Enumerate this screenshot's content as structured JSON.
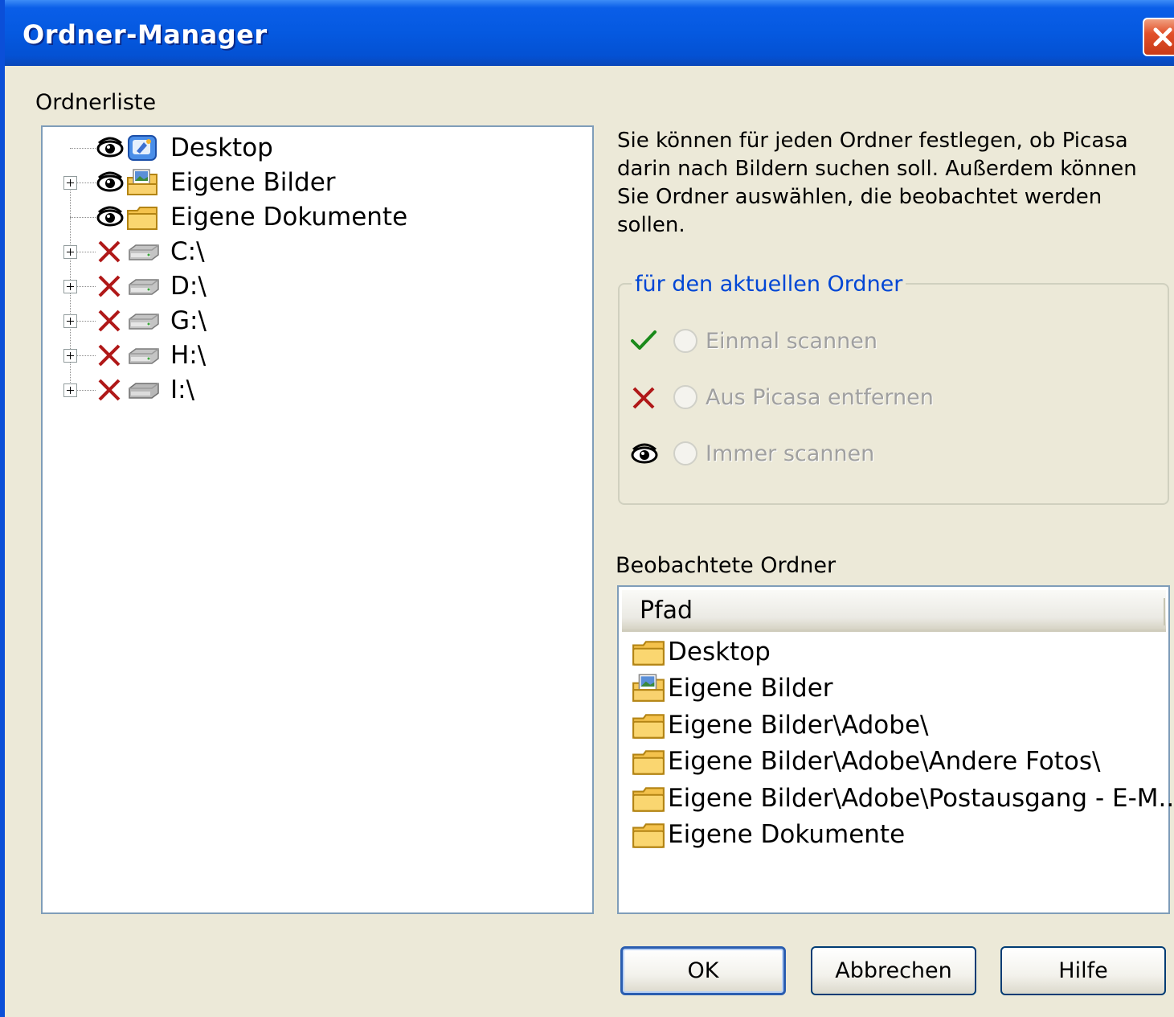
{
  "window": {
    "title": "Ordner-Manager"
  },
  "folder_list": {
    "label": "Ordnerliste",
    "items": [
      {
        "label": "Desktop",
        "status_icon": "eye-icon",
        "type_icon": "desktop-icon",
        "expandable": false
      },
      {
        "label": "Eigene Bilder",
        "status_icon": "eye-icon",
        "type_icon": "pictures-folder-icon",
        "expandable": true
      },
      {
        "label": "Eigene Dokumente",
        "status_icon": "eye-icon",
        "type_icon": "folder-icon",
        "expandable": false
      },
      {
        "label": "C:\\",
        "status_icon": "x-icon",
        "type_icon": "drive-icon",
        "expandable": true
      },
      {
        "label": "D:\\",
        "status_icon": "x-icon",
        "type_icon": "drive-icon",
        "expandable": true
      },
      {
        "label": "G:\\",
        "status_icon": "x-icon",
        "type_icon": "drive-icon",
        "expandable": true
      },
      {
        "label": "H:\\",
        "status_icon": "x-icon",
        "type_icon": "drive-icon",
        "expandable": true
      },
      {
        "label": "I:\\",
        "status_icon": "x-icon",
        "type_icon": "drive-icon",
        "expandable": true
      }
    ]
  },
  "description": "Sie können für jeden Ordner festlegen, ob Picasa darin nach Bildern suchen soll. Außerdem können Sie Ordner auswählen, die beobachtet werden sollen.",
  "current_folder_group": {
    "legend": "für den aktuellen Ordner",
    "options": [
      {
        "label": "Einmal scannen",
        "icon": "checkmark-icon",
        "enabled": false
      },
      {
        "label": "Aus Picasa entfernen",
        "icon": "x-icon",
        "enabled": false
      },
      {
        "label": "Immer scannen",
        "icon": "eye-icon",
        "enabled": false
      }
    ]
  },
  "watched_folders": {
    "label": "Beobachtete Ordner",
    "column_header": "Pfad",
    "items": [
      {
        "path": "Desktop",
        "icon": "folder-icon"
      },
      {
        "path": "Eigene Bilder",
        "icon": "pictures-folder-icon"
      },
      {
        "path": "Eigene Bilder\\Adobe\\",
        "icon": "folder-icon"
      },
      {
        "path": "Eigene Bilder\\Adobe\\Andere Fotos\\",
        "icon": "folder-icon"
      },
      {
        "path": "Eigene Bilder\\Adobe\\Postausgang - E-M...",
        "icon": "folder-icon"
      },
      {
        "path": "Eigene Dokumente",
        "icon": "folder-icon"
      }
    ]
  },
  "buttons": {
    "ok": "OK",
    "cancel": "Abbrechen",
    "help": "Hilfe"
  },
  "colors": {
    "titlebar": "#0559e0",
    "legend_text": "#0046d5",
    "check": "#1a8a1a",
    "x_mark": "#b01818"
  }
}
